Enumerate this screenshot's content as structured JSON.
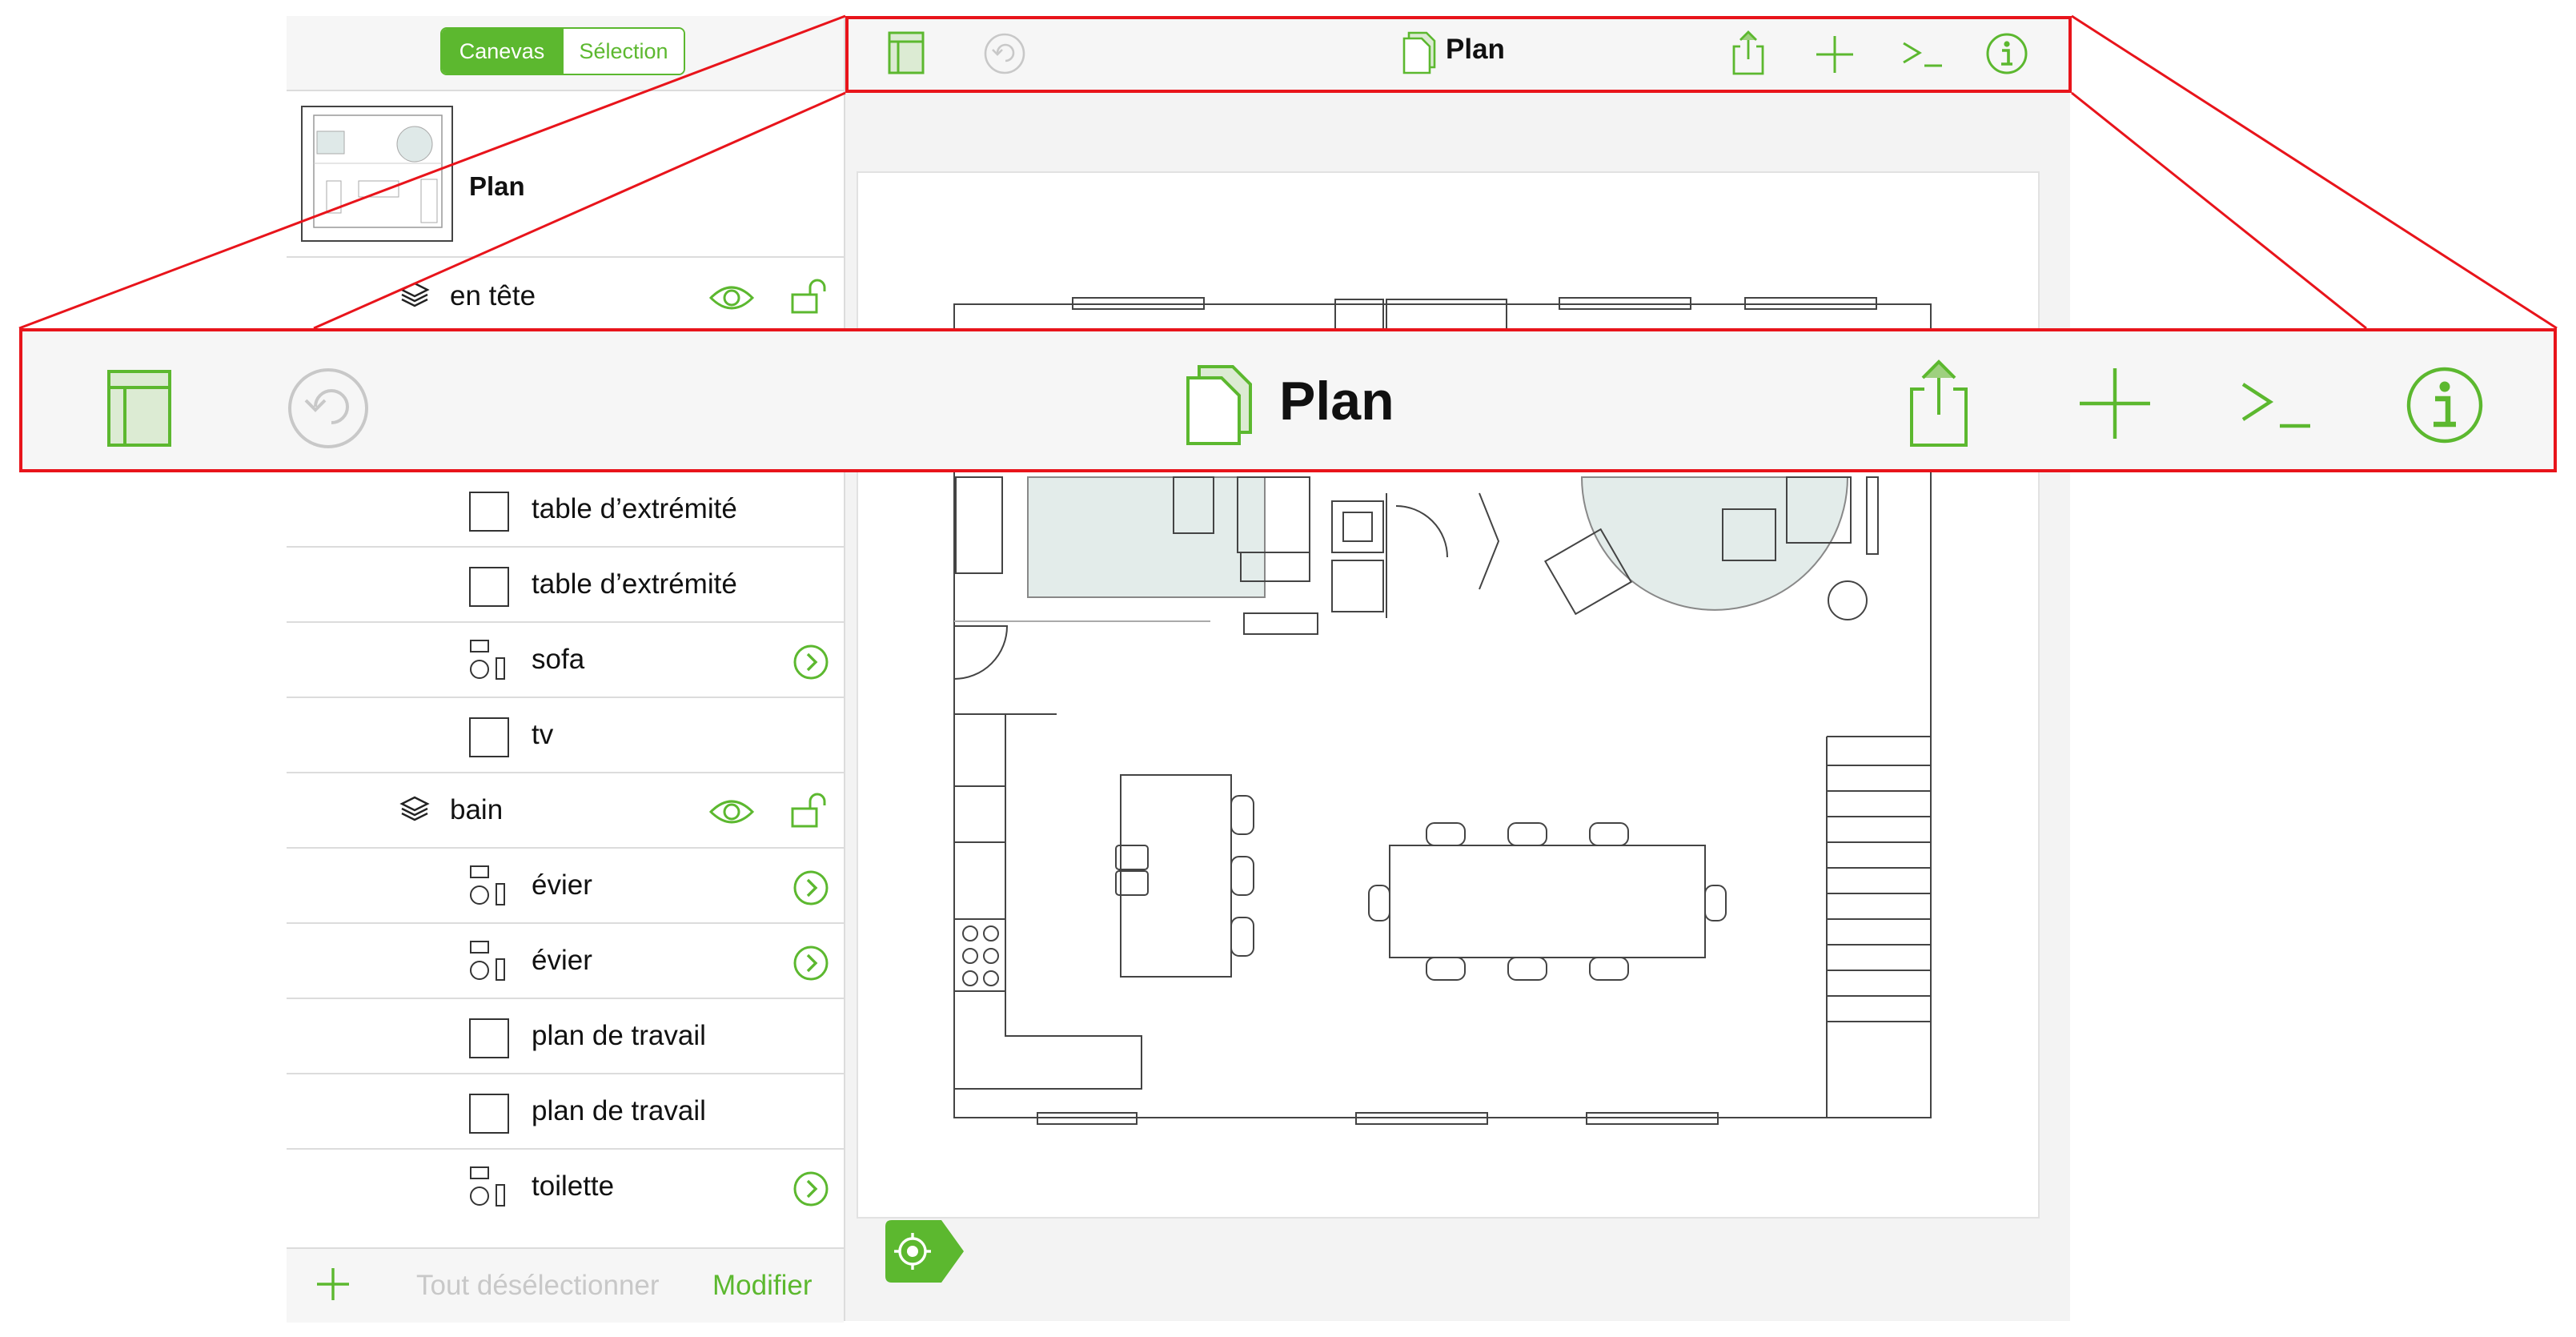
{
  "sidebar": {
    "segments": [
      "Canevas",
      "Sélection"
    ],
    "canvas_name": "Plan",
    "rows": [
      {
        "kind": "layer",
        "label": "en tête"
      },
      {
        "kind": "shape",
        "label": "table d’extrémité"
      },
      {
        "kind": "shape",
        "label": "table d’extrémité"
      },
      {
        "kind": "group",
        "label": "sofa"
      },
      {
        "kind": "shape",
        "label": "tv"
      },
      {
        "kind": "layer",
        "label": "bain"
      },
      {
        "kind": "group",
        "label": "évier"
      },
      {
        "kind": "group",
        "label": "évier"
      },
      {
        "kind": "shape",
        "label": "plan de travail"
      },
      {
        "kind": "shape",
        "label": "plan de travail"
      },
      {
        "kind": "group",
        "label": "toilette"
      }
    ],
    "footer": {
      "deselect_label": "Tout désélectionner",
      "edit_label": "Modifier"
    }
  },
  "toolbar": {
    "title": "Plan",
    "icons": [
      "sidebar-icon",
      "undo-icon",
      "document-icon",
      "share-icon",
      "add-icon",
      "console-icon",
      "info-icon"
    ]
  },
  "colors": {
    "accent": "#5cb82f",
    "callout": "#e8141b",
    "disabled": "#c8c8c8"
  }
}
